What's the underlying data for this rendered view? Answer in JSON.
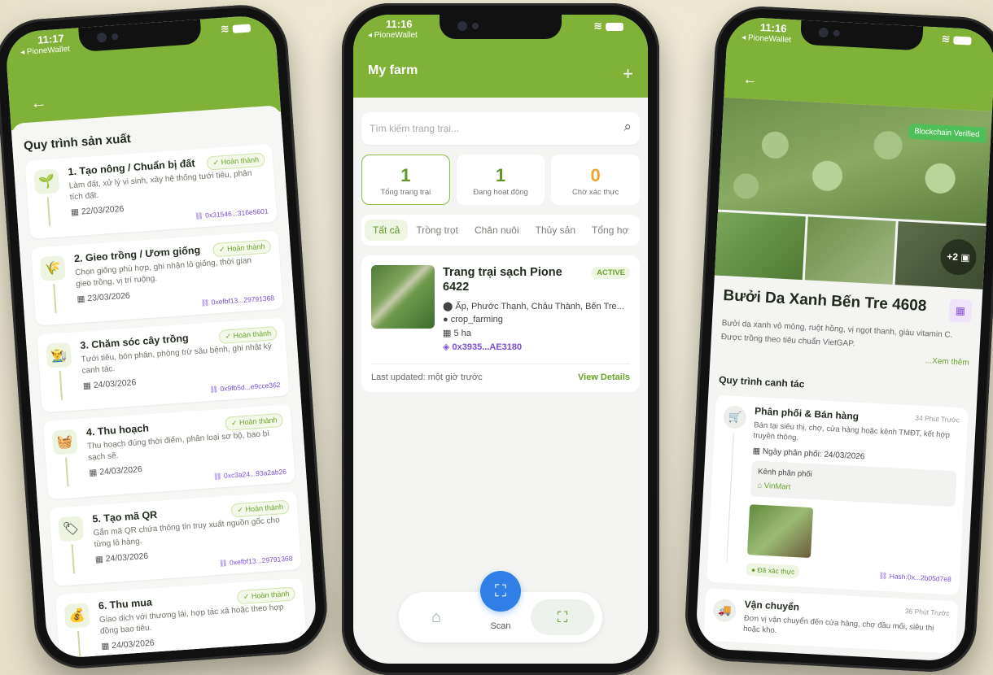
{
  "status": {
    "carrier": "◂ PioneWallet",
    "time_left": "11:17",
    "time_mid": "11:16",
    "time_right": "11:16"
  },
  "process_screen": {
    "title": "Quy trình sản xuất",
    "steps": [
      {
        "name": "1. Tạo nông / Chuẩn bị đất",
        "badge": "✓ Hoàn thành",
        "desc": "Làm đất, xử lý vi sinh, xây hệ thống tưới tiêu, phân tích đất.",
        "date": "22/03/2026",
        "hash": "0x31546...316e5601",
        "icon": "🌱"
      },
      {
        "name": "2. Gieo trồng / Ươm giống",
        "badge": "✓ Hoàn thành",
        "desc": "Chọn giống phù hợp, ghi nhận lô giống, thời gian gieo trồng, vị trí ruộng.",
        "date": "23/03/2026",
        "hash": "0xefbf13...29791368",
        "icon": "🌾"
      },
      {
        "name": "3. Chăm sóc cây trồng",
        "badge": "✓ Hoàn thành",
        "desc": "Tưới tiêu, bón phân, phòng trừ sâu bệnh, ghi nhật ký canh tác.",
        "date": "24/03/2026",
        "hash": "0x9fb5d...e9cce362",
        "icon": "👨‍🌾"
      },
      {
        "name": "4. Thu hoạch",
        "badge": "✓ Hoàn thành",
        "desc": "Thu hoạch đúng thời điểm, phân loại sơ bộ, bao bì sạch sẽ.",
        "date": "24/03/2026",
        "hash": "0xc3a24...93a2ab26",
        "icon": "🧺"
      },
      {
        "name": "5. Tạo mã QR",
        "badge": "✓ Hoàn thành",
        "desc": "Gắn mã QR chứa thông tin truy xuất nguồn gốc cho từng lô hàng.",
        "date": "24/03/2026",
        "hash": "0xefbf13...29791368",
        "icon": "🏷"
      },
      {
        "name": "6. Thu mua",
        "badge": "✓ Hoàn thành",
        "desc": "Giao dịch với thương lái, hợp tác xã hoặc theo hợp đồng bao tiêu.",
        "date": "24/03/2026",
        "hash": "",
        "icon": "💰"
      }
    ]
  },
  "farm_screen": {
    "title": "My farm",
    "search_placeholder": "Tìm kiếm trang trại...",
    "stats": [
      {
        "num": "1",
        "label": "Tổng trang trại"
      },
      {
        "num": "1",
        "label": "Đang hoạt động"
      },
      {
        "num": "0",
        "label": "Chờ xác thực"
      }
    ],
    "tabs": [
      "Tất cả",
      "Trồng trọt",
      "Chăn nuôi",
      "Thủy sản",
      "Tổng hợ"
    ],
    "farm": {
      "name": "Trang trại sạch Pione 6422",
      "status": "ACTIVE",
      "address": "Ấp, Phước Thạnh, Châu Thành, Bến Tre...",
      "type": "crop_farming",
      "area": "5 ha",
      "wallet": "0x3935...AE3180",
      "updated": "Last updated: một giờ trước",
      "view": "View Details"
    },
    "nav": {
      "scan": "Scan"
    }
  },
  "product_screen": {
    "verified": "Blockchain Verified",
    "more_photos": "+2",
    "name": "Bưởi Da Xanh Bến Tre 4608",
    "desc": "Bưởi da xanh vỏ mỏng, ruột hồng, vị ngọt thanh, giàu vitamin C. Được trồng theo tiêu chuẩn VietGAP.",
    "more": "...Xem thêm",
    "process_title": "Quy trình canh tác",
    "card1": {
      "name": "Phân phối & Bán hàng",
      "time": "34 Phút Trước",
      "desc": "Bán tại siêu thị, chợ, cửa hàng hoặc kênh TMĐT, kết hợp truyền thông.",
      "date": "Ngày phân phối: 24/03/2026",
      "channel_label": "Kênh phân phối",
      "channel_value": "VinMart",
      "verified": "Đã xác thực",
      "hash": "Hash:0x...2b05d7e8"
    },
    "card2": {
      "name": "Vận chuyển",
      "time": "36 Phút Trước",
      "desc": "Đơn vị vận chuyển đến cửa hàng, chợ đầu mối, siêu thị hoặc kho."
    }
  }
}
